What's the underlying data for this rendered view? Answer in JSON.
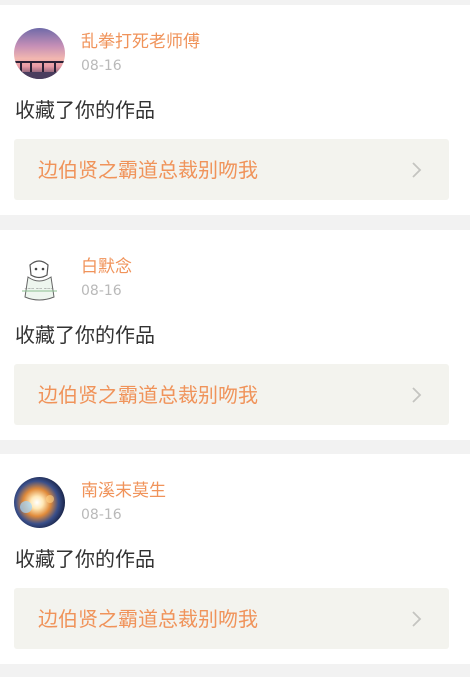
{
  "feed": {
    "items": [
      {
        "username": "乱拳打死老师傅",
        "date": "08-16",
        "action": "收藏了你的作品",
        "work_title": "边伯贤之霸道总裁别吻我",
        "avatar_icon": "sunset-pier-avatar"
      },
      {
        "username": "白默念",
        "date": "08-16",
        "action": "收藏了你的作品",
        "work_title": "边伯贤之霸道总裁别吻我",
        "avatar_icon": "sketch-cat-avatar"
      },
      {
        "username": "南溪末莫生",
        "date": "08-16",
        "action": "收藏了你的作品",
        "work_title": "边伯贤之霸道总裁别吻我",
        "avatar_icon": "light-flare-avatar"
      }
    ],
    "chevron_icon": "chevron-right-icon"
  },
  "colors": {
    "background": "#f2f2f2",
    "card": "#ffffff",
    "accent": "#f0935a",
    "date": "#b9b9b9",
    "action_text": "#333333",
    "link_background": "#f3f3ee"
  }
}
